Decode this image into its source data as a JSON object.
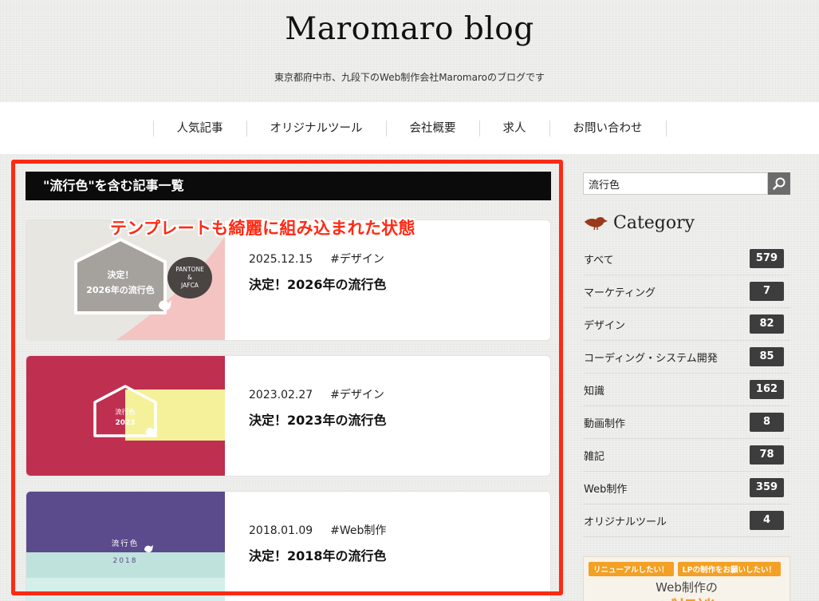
{
  "header": {
    "title": "Maromaro blog",
    "description": "東京都府中市、九段下のWeb制作会社Maromaroのブログです"
  },
  "nav": [
    "人気記事",
    "オリジナルツール",
    "会社概要",
    "求人",
    "お問い合わせ"
  ],
  "archive": {
    "heading": "\"流行色\"を含む記事一覧",
    "posts": [
      {
        "date": "2025.12.15",
        "tag": "#デザイン",
        "title": "決定！2026年の流行色",
        "thumb": {
          "line1": "決定！",
          "line2": "2026年の流行色",
          "badge_lines": [
            "PANTONE",
            "&",
            "JAFCA"
          ]
        }
      },
      {
        "date": "2023.02.27",
        "tag": "#デザイン",
        "title": "決定！2023年の流行色",
        "thumb": {
          "line1": "流行色",
          "line2": "2023"
        }
      },
      {
        "date": "2018.01.09",
        "tag": "#Web制作",
        "title": "決定！2018年の流行色",
        "thumb": {
          "line1": "流行色",
          "line2": "2018"
        }
      }
    ]
  },
  "annotation": {
    "note": "テンプレートも綺麗に組み込まれた状態",
    "color": "#ff2a14"
  },
  "sidebar": {
    "search": {
      "value": "流行色"
    },
    "category_heading": "Category",
    "categories": [
      {
        "name": "すべて",
        "count": "579"
      },
      {
        "name": "マーケティング",
        "count": "7"
      },
      {
        "name": "デザイン",
        "count": "82"
      },
      {
        "name": "コーディング・システム開発",
        "count": "85"
      },
      {
        "name": "知識",
        "count": "162"
      },
      {
        "name": "動画制作",
        "count": "8"
      },
      {
        "name": "雑記",
        "count": "78"
      },
      {
        "name": "Web制作",
        "count": "359"
      },
      {
        "name": "オリジナルツール",
        "count": "4"
      }
    ],
    "banner": {
      "pills": [
        "リニューアルしたい！",
        "LPの制作をお願いしたい！"
      ],
      "title": "Web制作の",
      "subtitle": "ご相談"
    }
  },
  "colors": {
    "accent": "#ff2a14",
    "badge": "#3d3d3d",
    "banner_orange": "#f3a024"
  }
}
